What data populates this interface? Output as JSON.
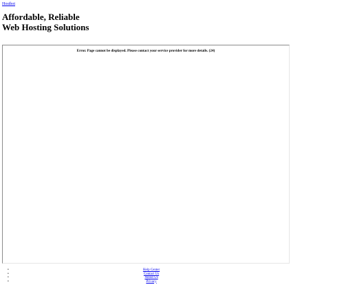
{
  "header": {
    "logo_alt": "Hostbot",
    "tagline_line1": "Affordable, Reliable",
    "tagline_line2": "Web Hosting Solutions"
  },
  "frame": {
    "error_message": "Error. Page cannot be displayed. Please contact your service provider for more details. (24)"
  },
  "footer": {
    "links": [
      {
        "label": "Help Center"
      },
      {
        "label": "Contact Us"
      },
      {
        "label": "About Us"
      },
      {
        "label": "Privacy"
      }
    ]
  }
}
